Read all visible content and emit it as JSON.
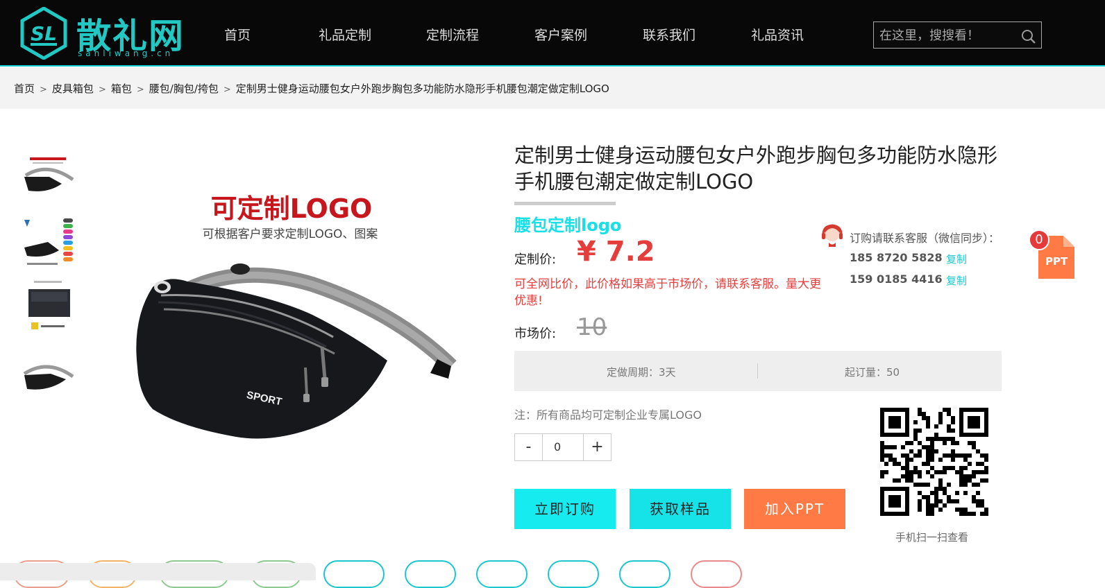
{
  "header": {
    "logo_text": "散礼网",
    "logo_sub": "sanliwang.cn",
    "nav": [
      "首页",
      "礼品定制",
      "定制流程",
      "客户案例",
      "联系我们",
      "礼品资讯"
    ],
    "search_placeholder": "在这里，搜搜看！"
  },
  "breadcrumb": [
    "首页",
    "皮具箱包",
    "箱包",
    "腰包/胸包/挎包",
    "定制男士健身运动腰包女户外跑步胸包多功能防水隐形手机腰包潮定做定制LOGO"
  ],
  "gallery": {
    "promo_title": "可定制LOGO",
    "promo_subtitle": "可根据客户要求定制LOGO、图案",
    "bag_text": "SPORT"
  },
  "product": {
    "title": "定制男士健身运动腰包女户外跑步胸包多功能防水隐形手机腰包潮定做定制LOGO",
    "subtitle": "腰包定制logo",
    "price_label": "定制价:",
    "price": "¥ 7.2",
    "price_note": "可全网比价，此价格如果高于市场价，请联系客服。量大更优惠!",
    "market_label": "市场价:",
    "market_price": "10",
    "period": "定做周期：3天",
    "moq": "起订量：50",
    "note": "注：所有商品均可定制企业专属LOGO",
    "qty_minus": "-",
    "qty_value": "0",
    "qty_plus": "+"
  },
  "buttons": {
    "buy": "立即订购",
    "sample": "获取样品",
    "ppt": "加入PPT"
  },
  "contact": {
    "title": "订购请联系客服（微信同步）：",
    "phones": [
      "185 8720 5828",
      "159 0185 4416"
    ],
    "copy_label": "复制",
    "qr_caption": "手机扫一扫查看"
  },
  "ppt_float": {
    "count": "0",
    "label": "PPT"
  },
  "colors": {
    "accent": "#16e3e8",
    "price": "#e53c3c",
    "ppt": "#ff7a45"
  }
}
